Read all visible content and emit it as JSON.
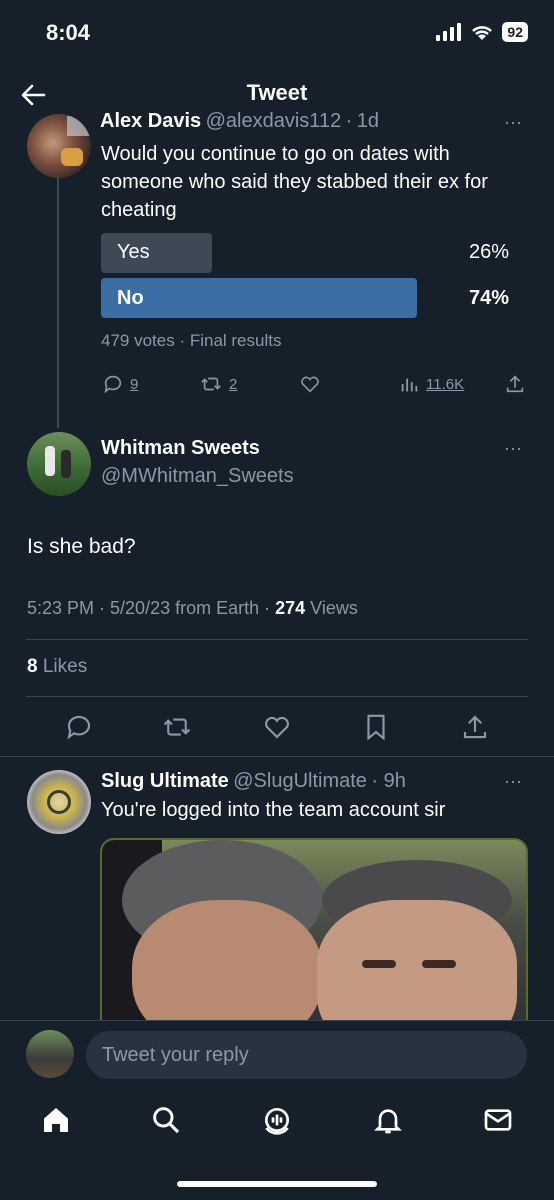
{
  "status": {
    "time": "8:04",
    "battery": "92"
  },
  "header": {
    "title": "Tweet"
  },
  "parent": {
    "name": "Alex Davis",
    "handle": "@alexdavis112",
    "age": "1d",
    "text_lines": [
      "Would you continue to go on dates with",
      "someone who said they stabbed their ex for",
      "cheating"
    ],
    "poll": {
      "options": [
        {
          "label": "Yes",
          "percent": "26%",
          "fraction": 0.26
        },
        {
          "label": "No",
          "percent": "74%",
          "fraction": 0.74
        }
      ],
      "summary": "479 votes · Final results"
    },
    "actions": {
      "replies": "9",
      "retweets": "2",
      "views": "11.6K"
    }
  },
  "main": {
    "name": "Whitman Sweets",
    "handle": "@MWhitman_Sweets",
    "text": "Is she bad?",
    "meta_prefix": "5:23 PM · 5/20/23 from Earth · ",
    "views_count": "274",
    "views_label": "Views",
    "likes_count": "8",
    "likes_label": "Likes"
  },
  "reply": {
    "name": "Slug Ultimate",
    "handle": "@SlugUltimate",
    "age": "· 9h",
    "text": "You're logged into the team account sir"
  },
  "composer": {
    "placeholder": "Tweet your reply"
  },
  "colors": {
    "background": "#15202b",
    "accent": "#3b6ea5",
    "muted": "#8b98a5",
    "divider": "#38444d"
  }
}
